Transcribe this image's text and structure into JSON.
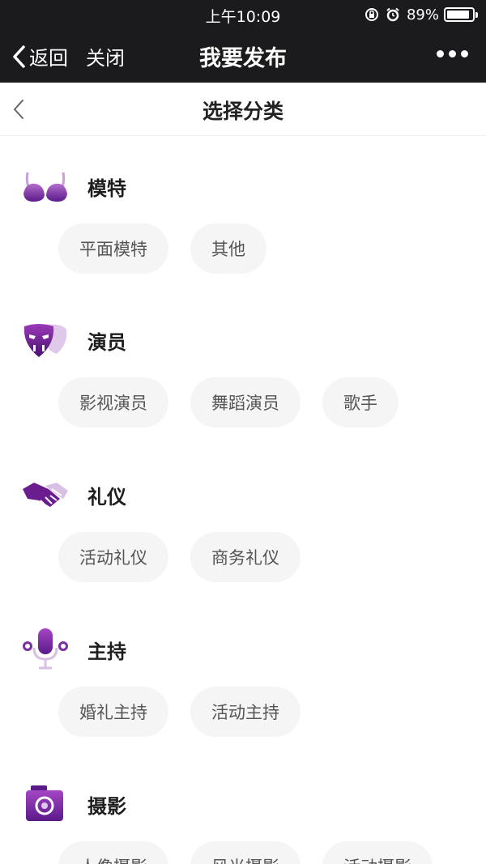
{
  "status_bar": {
    "time": "上午10:09",
    "battery": "89%",
    "battery_level": 0.89
  },
  "nav": {
    "back_label": "返回",
    "close_label": "关闭",
    "title": "我要发布"
  },
  "header": {
    "title": "选择分类"
  },
  "colors": {
    "accent": "#7b2fa3",
    "dark_bar": "#1b1b1d",
    "chip_bg": "#f5f5f5"
  },
  "categories": [
    {
      "name": "模特",
      "icon": "bra-icon",
      "tags": [
        "平面模特",
        "其他"
      ]
    },
    {
      "name": "演员",
      "icon": "theater-mask-icon",
      "tags": [
        "影视演员",
        "舞蹈演员",
        "歌手"
      ]
    },
    {
      "name": "礼仪",
      "icon": "handshake-icon",
      "tags": [
        "活动礼仪",
        "商务礼仪"
      ]
    },
    {
      "name": "主持",
      "icon": "microphone-icon",
      "tags": [
        "婚礼主持",
        "活动主持"
      ]
    },
    {
      "name": "摄影",
      "icon": "camera-icon",
      "tags": [
        "人像摄影",
        "风光摄影",
        "活动摄影"
      ]
    }
  ]
}
